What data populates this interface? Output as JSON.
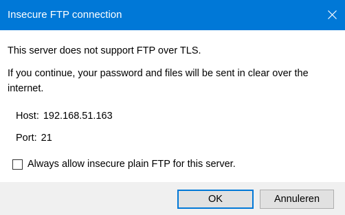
{
  "dialog": {
    "title": "Insecure FTP connection",
    "close_icon": "close-icon",
    "message_line1": "This server does not support FTP over TLS.",
    "message_line2": "If you continue, your password and files will be sent in clear over the internet.",
    "host_label": "Host:",
    "host_value": "192.168.51.163",
    "port_label": "Port:",
    "port_value": "21",
    "checkbox_label": "Always allow insecure plain FTP for this server.",
    "checkbox_checked": false,
    "ok_label": "OK",
    "cancel_label": "Annuleren"
  },
  "colors": {
    "titlebar": "#0078d7",
    "footer": "#f0f0f0",
    "default_button_border": "#0078d7"
  }
}
